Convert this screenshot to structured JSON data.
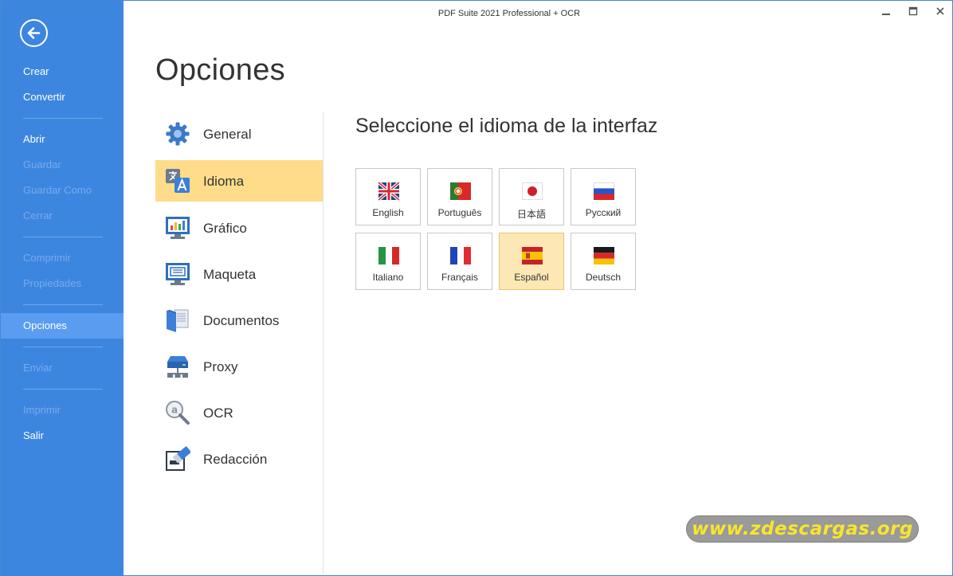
{
  "window": {
    "title": "PDF Suite 2021  Professional + OCR"
  },
  "sidebar": {
    "items": [
      {
        "label": "Crear",
        "state": "enabled"
      },
      {
        "label": "Convertir",
        "state": "enabled"
      },
      {
        "label": "Abrir",
        "state": "enabled"
      },
      {
        "label": "Guardar",
        "state": "disabled"
      },
      {
        "label": "Guardar Como",
        "state": "disabled"
      },
      {
        "label": "Cerrar",
        "state": "disabled"
      },
      {
        "label": "Comprimir",
        "state": "disabled"
      },
      {
        "label": "Propiedades",
        "state": "disabled"
      },
      {
        "label": "Opciones",
        "state": "active"
      },
      {
        "label": "Enviar",
        "state": "disabled"
      },
      {
        "label": "Imprimir",
        "state": "disabled"
      },
      {
        "label": "Salir",
        "state": "enabled"
      }
    ]
  },
  "page": {
    "title": "Opciones",
    "section_heading": "Seleccione el idioma de la interfaz"
  },
  "categories": [
    {
      "label": "General",
      "icon": "gear-icon"
    },
    {
      "label": "Idioma",
      "icon": "translate-icon",
      "selected": true
    },
    {
      "label": "Gráfico",
      "icon": "monitor-chart-icon"
    },
    {
      "label": "Maqueta",
      "icon": "monitor-layout-icon"
    },
    {
      "label": "Documentos",
      "icon": "documents-icon"
    },
    {
      "label": "Proxy",
      "icon": "network-server-icon"
    },
    {
      "label": "OCR",
      "icon": "ocr-magnifier-icon"
    },
    {
      "label": "Redacción",
      "icon": "eraser-icon"
    }
  ],
  "languages": [
    {
      "label": "English",
      "flag": "uk-flag-icon"
    },
    {
      "label": "Português",
      "flag": "portugal-flag-icon"
    },
    {
      "label": "日本語",
      "flag": "japan-flag-icon"
    },
    {
      "label": "Русский",
      "flag": "russia-flag-icon"
    },
    {
      "label": "Italiano",
      "flag": "italy-flag-icon"
    },
    {
      "label": "Français",
      "flag": "france-flag-icon"
    },
    {
      "label": "Español",
      "flag": "spain-flag-icon",
      "selected": true
    },
    {
      "label": "Deutsch",
      "flag": "germany-flag-icon"
    }
  ],
  "watermark": {
    "text": "www.zdescargas.org"
  },
  "colors": {
    "sidebar_bg": "#3d86e0",
    "sidebar_active": "#5a9cf0",
    "selected_category": "#fedc8a",
    "selected_tile": "#fde8b5",
    "watermark_text": "#f7e62c"
  }
}
